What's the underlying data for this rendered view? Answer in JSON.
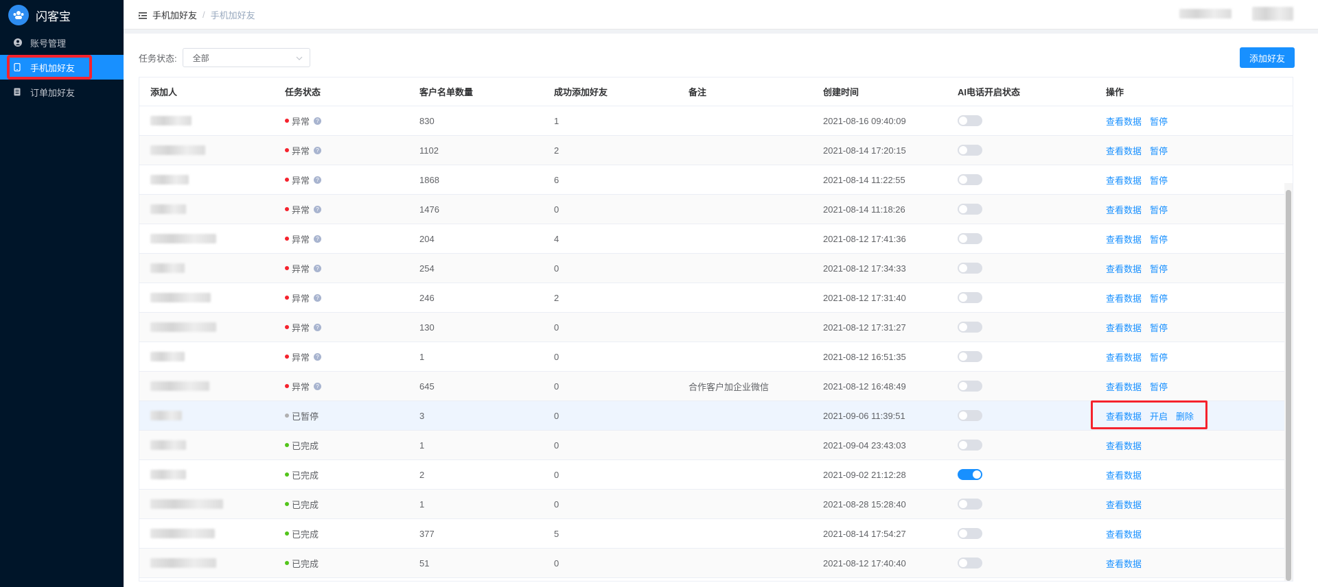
{
  "app": {
    "name": "闪客宝"
  },
  "sidebar": {
    "items": [
      {
        "label": "账号管理",
        "icon": "user-circle-icon"
      },
      {
        "label": "手机加好友",
        "icon": "phone-icon",
        "active": true
      },
      {
        "label": "订单加好友",
        "icon": "document-icon"
      }
    ]
  },
  "breadcrumb": {
    "first": "手机加好友",
    "second": "手机加好友",
    "separator": "/"
  },
  "filter": {
    "label": "任务状态:",
    "value": "全部"
  },
  "add_button": "添加好友",
  "table": {
    "columns": [
      "添加人",
      "任务状态",
      "客户名单数量",
      "成功添加好友",
      "备注",
      "创建时间",
      "AI电话开启状态",
      "操作"
    ],
    "rows": [
      {
        "status": "异常",
        "status_color": "#f5222d",
        "count": "830",
        "success": "1",
        "note": "",
        "time": "2021-08-16 09:40:09",
        "ai_on": false,
        "actions": [
          "查看数据",
          "暂停"
        ]
      },
      {
        "status": "异常",
        "status_color": "#f5222d",
        "count": "1102",
        "success": "2",
        "note": "",
        "time": "2021-08-14 17:20:15",
        "ai_on": false,
        "actions": [
          "查看数据",
          "暂停"
        ]
      },
      {
        "status": "异常",
        "status_color": "#f5222d",
        "count": "1868",
        "success": "6",
        "note": "",
        "time": "2021-08-14 11:22:55",
        "ai_on": false,
        "actions": [
          "查看数据",
          "暂停"
        ]
      },
      {
        "status": "异常",
        "status_color": "#f5222d",
        "count": "1476",
        "success": "0",
        "note": "",
        "time": "2021-08-14 11:18:26",
        "ai_on": false,
        "actions": [
          "查看数据",
          "暂停"
        ]
      },
      {
        "status": "异常",
        "status_color": "#f5222d",
        "count": "204",
        "success": "4",
        "note": "",
        "time": "2021-08-12 17:41:36",
        "ai_on": false,
        "actions": [
          "查看数据",
          "暂停"
        ]
      },
      {
        "status": "异常",
        "status_color": "#f5222d",
        "count": "254",
        "success": "0",
        "note": "",
        "time": "2021-08-12 17:34:33",
        "ai_on": false,
        "actions": [
          "查看数据",
          "暂停"
        ]
      },
      {
        "status": "异常",
        "status_color": "#f5222d",
        "count": "246",
        "success": "2",
        "note": "",
        "time": "2021-08-12 17:31:40",
        "ai_on": false,
        "actions": [
          "查看数据",
          "暂停"
        ]
      },
      {
        "status": "异常",
        "status_color": "#f5222d",
        "count": "130",
        "success": "0",
        "note": "",
        "time": "2021-08-12 17:31:27",
        "ai_on": false,
        "actions": [
          "查看数据",
          "暂停"
        ]
      },
      {
        "status": "异常",
        "status_color": "#f5222d",
        "count": "1",
        "success": "0",
        "note": "",
        "time": "2021-08-12 16:51:35",
        "ai_on": false,
        "actions": [
          "查看数据",
          "暂停"
        ]
      },
      {
        "status": "异常",
        "status_color": "#f5222d",
        "count": "645",
        "success": "0",
        "note": "合作客户加企业微信",
        "time": "2021-08-12 16:48:49",
        "ai_on": false,
        "actions": [
          "查看数据",
          "暂停"
        ]
      },
      {
        "status": "已暂停",
        "status_color": "#b0b0b0",
        "count": "3",
        "success": "0",
        "note": "",
        "time": "2021-09-06 11:39:51",
        "ai_on": false,
        "actions": [
          "查看数据",
          "开启",
          "删除"
        ]
      },
      {
        "status": "已完成",
        "status_color": "#52c41a",
        "count": "1",
        "success": "0",
        "note": "",
        "time": "2021-09-04 23:43:03",
        "ai_on": false,
        "actions": [
          "查看数据"
        ]
      },
      {
        "status": "已完成",
        "status_color": "#52c41a",
        "count": "2",
        "success": "0",
        "note": "",
        "time": "2021-09-02 21:12:28",
        "ai_on": true,
        "actions": [
          "查看数据"
        ]
      },
      {
        "status": "已完成",
        "status_color": "#52c41a",
        "count": "1",
        "success": "0",
        "note": "",
        "time": "2021-08-28 15:28:40",
        "ai_on": false,
        "actions": [
          "查看数据"
        ]
      },
      {
        "status": "已完成",
        "status_color": "#52c41a",
        "count": "377",
        "success": "5",
        "note": "",
        "time": "2021-08-14 17:54:27",
        "ai_on": false,
        "actions": [
          "查看数据"
        ]
      },
      {
        "status": "已完成",
        "status_color": "#52c41a",
        "count": "51",
        "success": "0",
        "note": "",
        "time": "2021-08-12 17:40:40",
        "ai_on": false,
        "actions": [
          "查看数据"
        ]
      }
    ]
  },
  "colors": {
    "sidebar_bg": "#001529",
    "accent": "#1890ff",
    "highlight_box": "#f5222d"
  }
}
